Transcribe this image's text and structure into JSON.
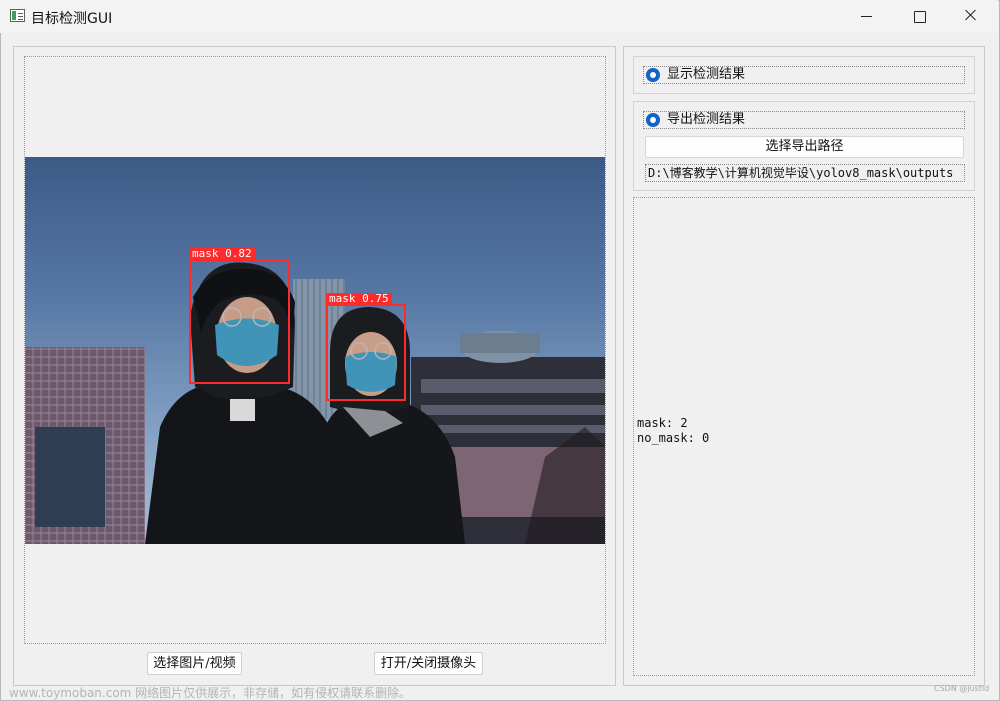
{
  "window": {
    "title": "目标检测GUI"
  },
  "left_panel": {
    "image_alt": "Detection result image showing two people wearing face masks",
    "detections": [
      {
        "label": "mask 0.82"
      },
      {
        "label": "mask 0.75"
      }
    ],
    "select_button_label": "选择图片/视频",
    "camera_button_label": "打开/关闭摄像头"
  },
  "right_panel": {
    "show_results": {
      "label": "显示检测结果",
      "checked": true
    },
    "export_results": {
      "label": "导出检测结果",
      "checked": true
    },
    "select_export_path_label": "选择导出路径",
    "export_path": "D:\\博客教学\\计算机视觉毕设\\yolov8_mask\\outputs",
    "results": [
      "mask: 2",
      "no_mask: 0"
    ]
  },
  "watermark": {
    "text": "www.toymoban.com 网络图片仅供展示，非存储，如有侵权请联系删除。",
    "csdn": "CSDN @justld"
  },
  "colors": {
    "accent": "#1262c9",
    "detection_box": "#ff2b2b",
    "window_bg": "#f0f0f0"
  }
}
